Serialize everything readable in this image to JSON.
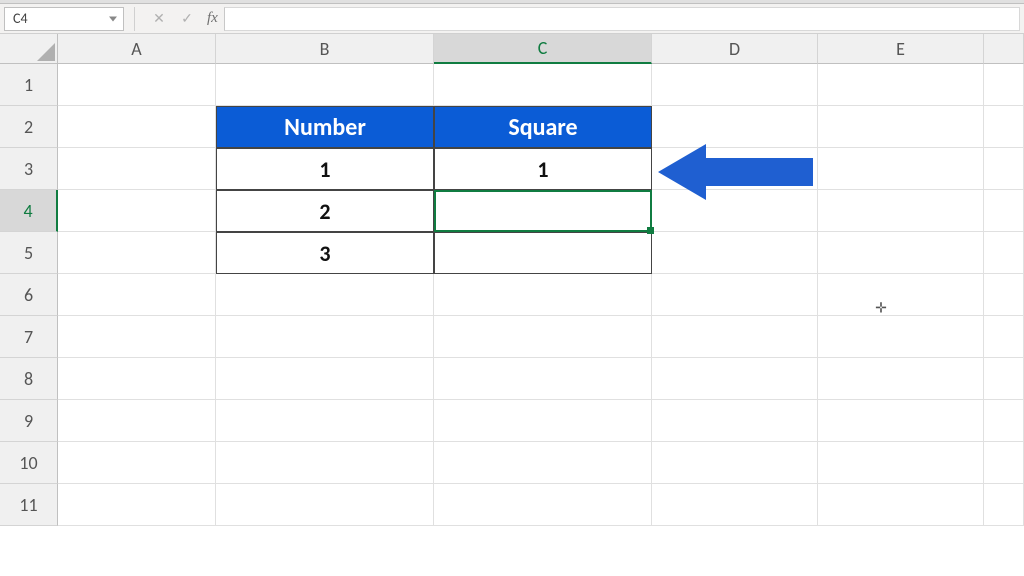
{
  "formula_bar": {
    "name_box": "C4",
    "cancel_icon": "✕",
    "enter_icon": "✓",
    "fx_label": "fx",
    "formula_text": ""
  },
  "columns": [
    "A",
    "B",
    "C",
    "D",
    "E",
    ""
  ],
  "rows": [
    "1",
    "2",
    "3",
    "4",
    "5",
    "6",
    "7",
    "8",
    "9",
    "10",
    "11"
  ],
  "active_cell": "C4",
  "selected_col_index": 2,
  "selected_row_index": 3,
  "table": {
    "headers": [
      "Number",
      "Square"
    ],
    "data": [
      {
        "number": "1",
        "square": "1"
      },
      {
        "number": "2",
        "square": ""
      },
      {
        "number": "3",
        "square": ""
      }
    ]
  },
  "annotation": {
    "arrow_color": "#1f5fd1"
  }
}
